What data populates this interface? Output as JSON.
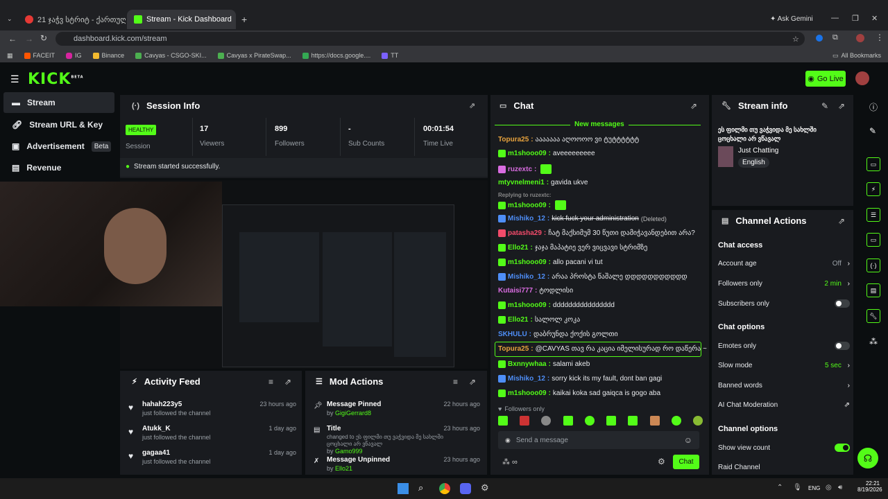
{
  "browser": {
    "tabs": [
      {
        "label": "21 ჯაჭვ სტრიტ - ქართულ..."
      },
      {
        "label": "Stream - Kick Dashboard"
      }
    ],
    "ask": "Ask Gemini",
    "url": "dashboard.kick.com/stream",
    "bookmarks": [
      "FACEIT",
      "IG",
      "Binance",
      "Cavyas - CSGO-SKI...",
      "Cavyas x PirateSwap...",
      "https://docs.google....",
      "TT"
    ],
    "all_bookmarks": "All Bookmarks"
  },
  "kick": {
    "logo": "KICK",
    "beta": "BETA",
    "go_live": "Go Live",
    "sidebar": [
      {
        "label": "Stream"
      },
      {
        "label": "Stream URL & Key"
      },
      {
        "label": "Advertisement",
        "badge": "Beta"
      },
      {
        "label": "Revenue"
      }
    ]
  },
  "session": {
    "title": "Session Info",
    "health": "HEALTHY",
    "session_label": "Session",
    "stats": [
      {
        "value": "17",
        "label": "Viewers"
      },
      {
        "value": "899",
        "label": "Followers"
      },
      {
        "value": "-",
        "label": "Sub Counts"
      },
      {
        "value": "00:01:54",
        "label": "Time Live"
      }
    ],
    "success": "Stream started successfully."
  },
  "activity": {
    "title": "Activity Feed",
    "items": [
      {
        "name": "hahah223y5",
        "sub": "just followed the channel",
        "time": "23 hours ago"
      },
      {
        "name": "Atukk_K",
        "sub": "just followed the channel",
        "time": "1 day ago"
      },
      {
        "name": "gagaa41",
        "sub": "just followed the channel",
        "time": "1 day ago"
      }
    ]
  },
  "mod": {
    "title": "Mod Actions",
    "items": [
      {
        "action": "Message Pinned",
        "by": "by",
        "user": "GigiGerrard8",
        "time": "22 hours ago"
      },
      {
        "action": "Title",
        "detail": "changed to ეს ფილმი თუ ვაჭვიდა მე სახლში ცოცხალი არ ვწავალ",
        "by": "by",
        "user": "Gamo999",
        "time": "23 hours ago"
      },
      {
        "action": "Message Unpinned",
        "by": "by",
        "user": "Ello21",
        "time": "23 hours ago"
      }
    ]
  },
  "chat": {
    "title": "Chat",
    "new_messages": "New messages",
    "lines": [
      {
        "user": "Topura25",
        "msg": "ააააააა აღოოოო ვი ტუტტტტტტ",
        "color": "#e8a33d"
      },
      {
        "user": "m1shooo09",
        "msg": "aveeeeeeeee",
        "color": "#53fc18"
      },
      {
        "user": "ruzextc",
        "msg": "",
        "color": "#d96ce0"
      },
      {
        "user": "mtyvnelmeni1",
        "msg": "gavida ukve",
        "color": "#53fc18"
      },
      {
        "user": "Replying to ruzextc:",
        "msg": "",
        "color": "#888888"
      },
      {
        "user": "m1shooo09",
        "msg": "",
        "color": "#53fc18"
      },
      {
        "user": "Mishiko_12",
        "msg": "kick fuck your administration",
        "deleted": "(Deleted)",
        "color": "#4e8ef7"
      },
      {
        "user": "patasha29",
        "msg": "ჩატ მაქსიმუმ 30 წუთი დამიჭავანდებით არა?",
        "color": "#f24b6a"
      },
      {
        "user": "Ello21",
        "msg": "ჯაჯა მაპატიე ვერ ვიცვავი სტრიმზე",
        "color": "#53fc18"
      },
      {
        "user": "m1shooo09",
        "msg": "allo pacani vi tut",
        "color": "#53fc18"
      },
      {
        "user": "Mishiko_12",
        "msg": "არაა პროსტა წაშალე დდდდდდდდდდდ",
        "color": "#4e8ef7"
      },
      {
        "user": "Kutaisi777",
        "msg": "ტოდლისი",
        "color": "#d96ce0"
      },
      {
        "user": "m1shooo09",
        "msg": "dddddddddddddddd",
        "color": "#53fc18"
      },
      {
        "user": "Ello21",
        "msg": "სალოლ კოკა",
        "color": "#53fc18"
      },
      {
        "user": "SKHULU",
        "msg": "დაბრუნდა ქოქის გოლთი",
        "color": "#4e8ef7"
      },
      {
        "user": "Topura25",
        "msg": "@CAVYAS თავ რა კაცია იმელისურად რო დაწერა ~",
        "color": "#e8a33d"
      },
      {
        "user": "Bxnnywhaa",
        "msg": "salami akeb",
        "color": "#53fc18"
      },
      {
        "user": "Mishiko_12",
        "msg": "sorry kick its my fault, dont ban gagi",
        "color": "#4e8ef7"
      },
      {
        "user": "m1shooo09",
        "msg": "kaikai koka sad gaiqca is gogo aba",
        "color": "#53fc18"
      }
    ],
    "followers_only": "Followers only",
    "placeholder": "Send a message",
    "send": "Chat"
  },
  "stream_info": {
    "title": "Stream info",
    "stream_title": "ეს ფილმი თუ ვაჭვიდა მე სახლში ცოცხალი არ ვწავალ",
    "category": "Just Chatting",
    "language": "English"
  },
  "channel": {
    "title": "Channel Actions",
    "chat_access": "Chat access",
    "account_age": "Account age",
    "account_age_val": "Off",
    "followers_only": "Followers only",
    "followers_only_val": "2 min",
    "subscribers_only": "Subscribers only",
    "chat_options": "Chat options",
    "emotes_only": "Emotes only",
    "slow_mode": "Slow mode",
    "slow_mode_val": "5 sec",
    "banned_words": "Banned words",
    "ai_mod": "AI Chat Moderation",
    "channel_options": "Channel options",
    "show_view_count": "Show view count",
    "raid": "Raid Channel"
  },
  "taskbar": {
    "lang": "ENG",
    "time": "22:21",
    "date": "8/19/2026"
  }
}
